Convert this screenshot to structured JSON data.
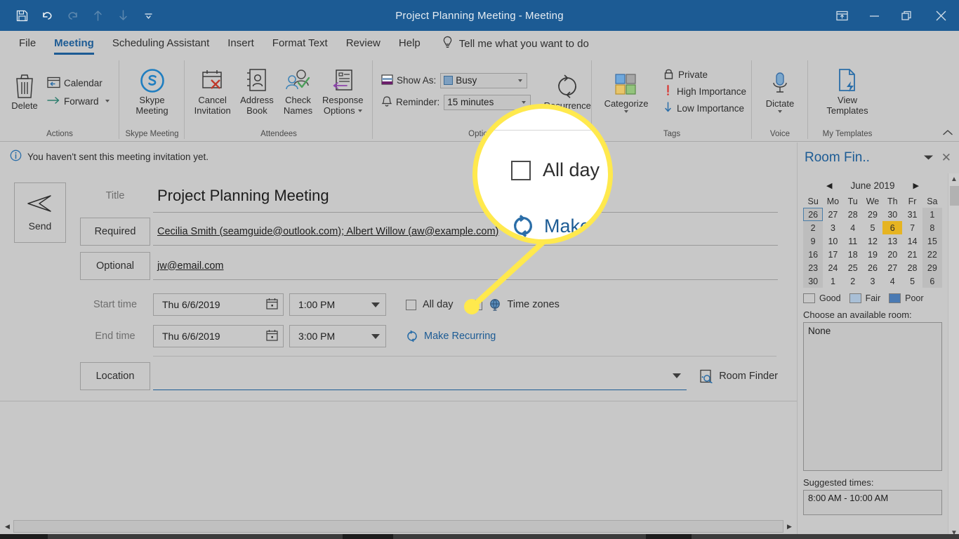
{
  "window": {
    "title": "Project Planning Meeting",
    "title_separator": "-",
    "title_suffix": "Meeting",
    "quick_access": [
      {
        "name": "save-icon",
        "label": "Save"
      },
      {
        "name": "undo-icon",
        "label": "Undo"
      },
      {
        "name": "redo-icon",
        "label": "Redo"
      },
      {
        "name": "previous-item-icon",
        "label": "Previous Item"
      },
      {
        "name": "next-item-icon",
        "label": "Next Item"
      },
      {
        "name": "customize-quick-access-toolbar-icon",
        "label": "Customize Quick Access Toolbar"
      }
    ],
    "controls": {
      "ribbon_display": "Ribbon Display Options",
      "minimize": "Minimize",
      "restore": "Restore Down",
      "close": "Close"
    }
  },
  "tabs": [
    {
      "label": "File",
      "active": false
    },
    {
      "label": "Meeting",
      "active": true
    },
    {
      "label": "Scheduling Assistant",
      "active": false
    },
    {
      "label": "Insert",
      "active": false
    },
    {
      "label": "Format Text",
      "active": false
    },
    {
      "label": "Review",
      "active": false
    },
    {
      "label": "Help",
      "active": false
    }
  ],
  "tell_me": {
    "label": "Tell me what you want to do",
    "icon": "lightbulb-icon"
  },
  "ribbon": {
    "groups": [
      {
        "label": "Actions"
      },
      {
        "label": "Skype Meeting"
      },
      {
        "label": "Attendees"
      },
      {
        "label": "Options"
      },
      {
        "label": "Tags"
      },
      {
        "label": "Voice"
      },
      {
        "label": "My Templates"
      }
    ],
    "actions": {
      "delete": "Delete",
      "calendar": "Calendar",
      "forward": "Forward"
    },
    "skype": {
      "line1": "Skype",
      "line2": "Meeting"
    },
    "attendees": {
      "cancel_invitation_1": "Cancel",
      "cancel_invitation_2": "Invitation",
      "address_book_1": "Address",
      "address_book_2": "Book",
      "check_names_1": "Check",
      "check_names_2": "Names",
      "response_options_1": "Response",
      "response_options_2": "Options"
    },
    "options": {
      "show_as_label": "Show As:",
      "show_as_value": "Busy",
      "reminder_label": "Reminder:",
      "reminder_value": "15 minutes",
      "recurrence": "Recurrence"
    },
    "tags": {
      "categorize": "Categorize",
      "private": "Private",
      "high_importance": "High Importance",
      "low_importance": "Low Importance"
    },
    "voice": {
      "dictate": "Dictate"
    },
    "templates": {
      "line1": "View",
      "line2": "Templates"
    },
    "collapse_label": "Collapse the Ribbon"
  },
  "infobar": {
    "icon": "info-icon",
    "message": "You haven't sent this meeting invitation yet."
  },
  "form": {
    "send_label": "Send",
    "title_label": "Title",
    "title_value": "Project Planning Meeting",
    "required_label": "Required",
    "required_value": "Cecilia Smith (seamguide@outlook.com); Albert Willow (aw@example.com)",
    "optional_label": "Optional",
    "optional_value": "jw@email.com",
    "start_time_label": "Start time",
    "start_date_value": "Thu 6/6/2019",
    "start_time_value": "1:00 PM",
    "end_time_label": "End time",
    "end_date_value": "Thu 6/6/2019",
    "end_time_value": "3:00 PM",
    "all_day_label": "All day",
    "time_zones_label": "Time zones",
    "make_recurring_label": "Make Recurring",
    "location_label": "Location",
    "location_value": "",
    "room_finder_label": "Room Finder"
  },
  "room_finder": {
    "title": "Room Fin..",
    "close": "Close",
    "month_label": "June 2019",
    "prev_label": "Previous month",
    "next_label": "Next month",
    "weekday_headers": [
      "Su",
      "Mo",
      "Tu",
      "We",
      "Th",
      "Fr",
      "Sa"
    ],
    "weeks": [
      [
        {
          "d": "26",
          "dim": true,
          "weekend": true,
          "today": true
        },
        {
          "d": "27",
          "dim": true
        },
        {
          "d": "28",
          "dim": true
        },
        {
          "d": "29",
          "dim": true
        },
        {
          "d": "30",
          "dim": true
        },
        {
          "d": "31",
          "dim": true
        },
        {
          "d": "1",
          "weekend": true
        }
      ],
      [
        {
          "d": "2",
          "weekend": true
        },
        {
          "d": "3"
        },
        {
          "d": "4"
        },
        {
          "d": "5"
        },
        {
          "d": "6",
          "selected": true
        },
        {
          "d": "7"
        },
        {
          "d": "8",
          "weekend": true
        }
      ],
      [
        {
          "d": "9",
          "weekend": true
        },
        {
          "d": "10"
        },
        {
          "d": "11"
        },
        {
          "d": "12"
        },
        {
          "d": "13"
        },
        {
          "d": "14"
        },
        {
          "d": "15",
          "weekend": true
        }
      ],
      [
        {
          "d": "16",
          "weekend": true
        },
        {
          "d": "17"
        },
        {
          "d": "18"
        },
        {
          "d": "19"
        },
        {
          "d": "20"
        },
        {
          "d": "21"
        },
        {
          "d": "22",
          "weekend": true
        }
      ],
      [
        {
          "d": "23",
          "weekend": true
        },
        {
          "d": "24"
        },
        {
          "d": "25"
        },
        {
          "d": "26"
        },
        {
          "d": "27"
        },
        {
          "d": "28"
        },
        {
          "d": "29",
          "weekend": true
        }
      ],
      [
        {
          "d": "30",
          "weekend": true
        },
        {
          "d": "1",
          "dim": true
        },
        {
          "d": "2",
          "dim": true
        },
        {
          "d": "3",
          "dim": true
        },
        {
          "d": "4",
          "dim": true
        },
        {
          "d": "5",
          "dim": true
        },
        {
          "d": "6",
          "dim": true,
          "weekend": true
        }
      ]
    ],
    "legend": [
      {
        "label": "Good",
        "color": "#c8c8c8"
      },
      {
        "label": "Fair",
        "color": "#a9bfd6"
      },
      {
        "label": "Poor",
        "color": "#4a7ab3"
      }
    ],
    "choose_room_label": "Choose an available room:",
    "room_list": [
      "None"
    ],
    "suggested_times_label": "Suggested times:",
    "suggested_time_value": "8:00 AM - 10:00 AM"
  },
  "callout": {
    "all_day_label": "All day",
    "make_recurring_label": "Make R",
    "highlight_color": "#ffe94d"
  },
  "colors": {
    "titlebar": "#1c5b94",
    "chrome": "#c8c8c8",
    "accent_blue": "#1c5b94",
    "selected_day": "#e6b422"
  }
}
